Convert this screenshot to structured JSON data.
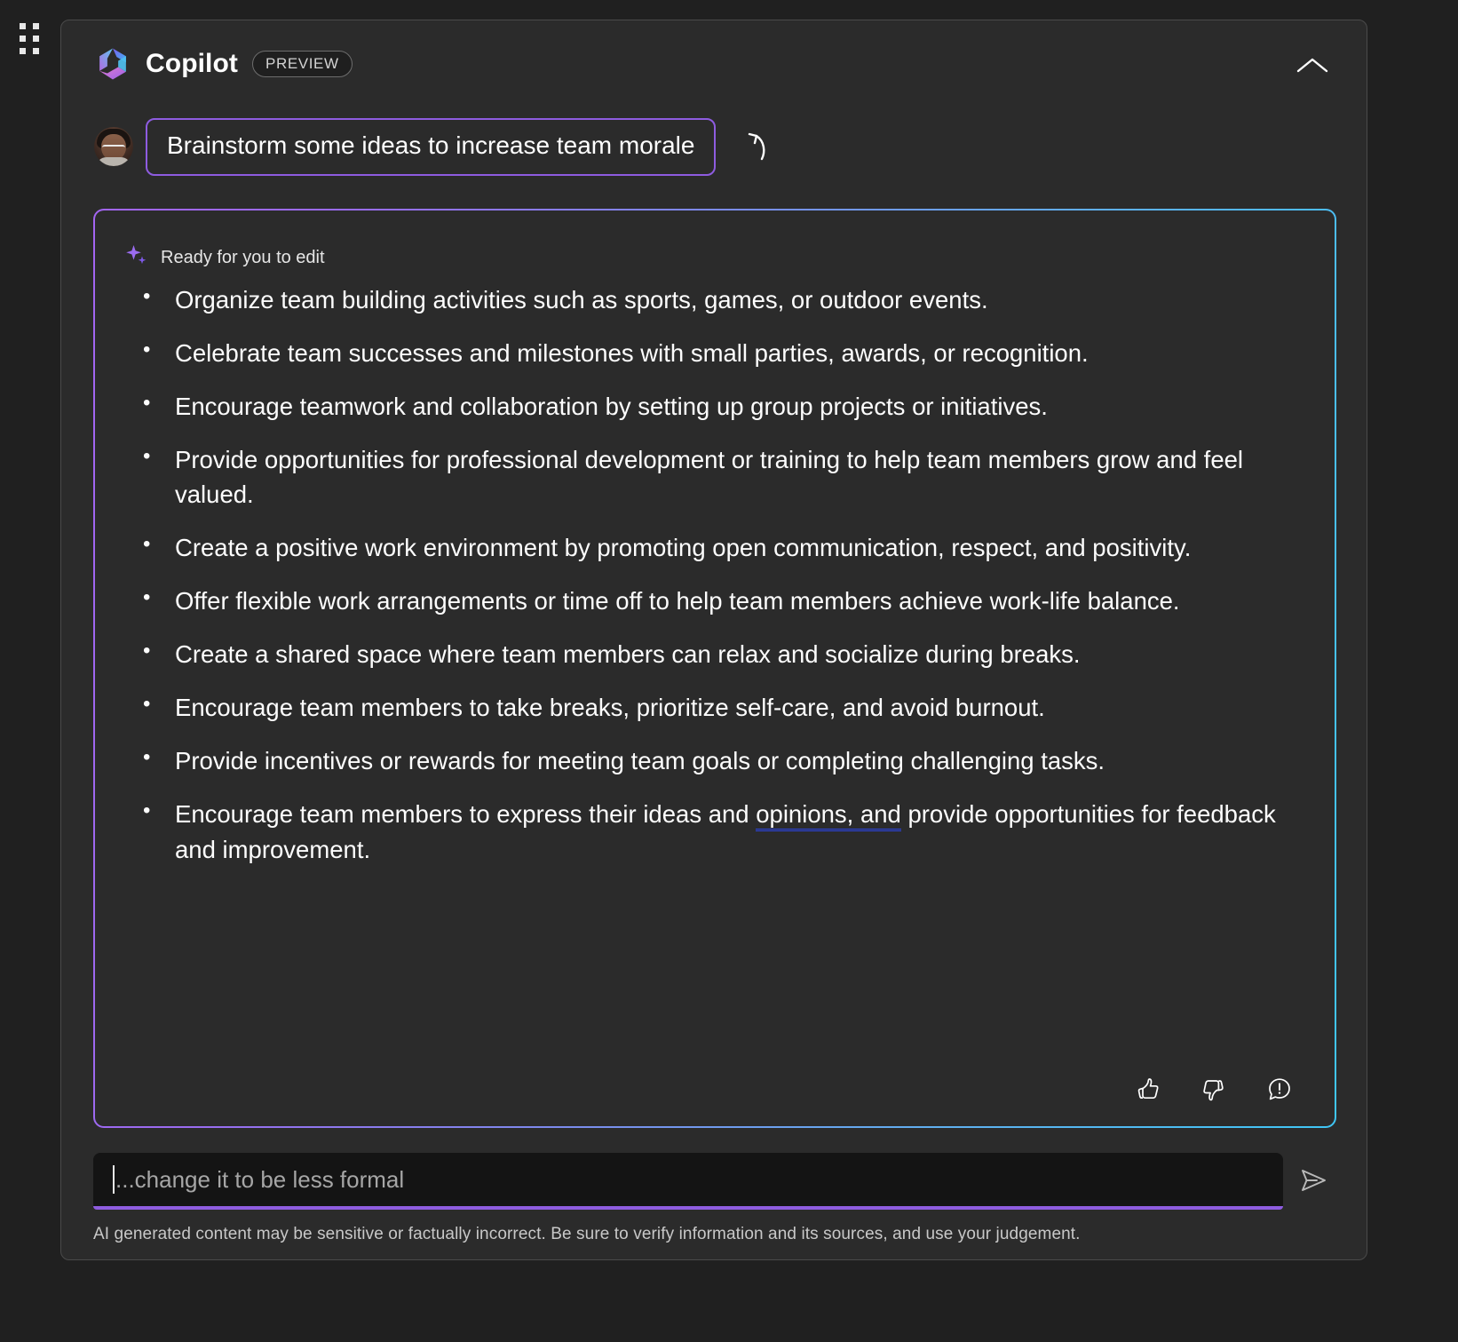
{
  "window": {
    "drag_handle_icon": "grid-dots-icon",
    "collapse_icon": "chevron-up-icon"
  },
  "header": {
    "logo_icon": "copilot-logo-icon",
    "title": "Copilot",
    "badge": "PREVIEW"
  },
  "prompt": {
    "avatar_icon": "user-avatar",
    "text": "Brainstorm some ideas to increase team morale",
    "regenerate_icon": "regenerate-arrow-icon"
  },
  "response": {
    "status_icon": "sparkle-icon",
    "status_label": "Ready for you to edit",
    "bullets": [
      {
        "text": "Organize team building activities such as sports, games, or outdoor events."
      },
      {
        "text": "Celebrate team successes and milestones with small parties, awards, or recognition."
      },
      {
        "text": "Encourage teamwork and collaboration by setting up group projects or initiatives."
      },
      {
        "text": "Provide opportunities for professional development or training to help team members grow and feel valued."
      },
      {
        "text": "Create a positive work environment by promoting open communication, respect, and positivity."
      },
      {
        "text": "Offer flexible work arrangements or time off to help team members achieve work-life balance."
      },
      {
        "text": "Create a shared space where team members can relax and socialize during breaks."
      },
      {
        "text": "Encourage team members to take breaks, prioritize self-care, and avoid burnout."
      },
      {
        "text": "Provide incentives or rewards for meeting team goals or completing challenging tasks."
      },
      {
        "pre": "Encourage team members to express their ideas and ",
        "underlined": "opinions, and",
        "post": " provide opportunities for feedback and improvement."
      }
    ],
    "feedback": {
      "like_icon": "thumbs-up-icon",
      "dislike_icon": "thumbs-down-icon",
      "report_icon": "feedback-alert-icon"
    }
  },
  "composer": {
    "placeholder": "...change it to be less formal",
    "value": "",
    "send_icon": "send-paper-plane-icon"
  },
  "footer": {
    "disclaimer": "AI generated content may be sensitive or factually incorrect. Be sure to verify information and its sources, and use your judgement."
  },
  "colors": {
    "panel_bg": "#2b2b2b",
    "page_bg": "#202020",
    "accent_purple": "#8e5ce0",
    "accent_cyan": "#3fc6f5",
    "grammar_underline": "#2b44e8",
    "text_primary": "#fdfdfd",
    "text_muted": "#c8c8c8"
  }
}
